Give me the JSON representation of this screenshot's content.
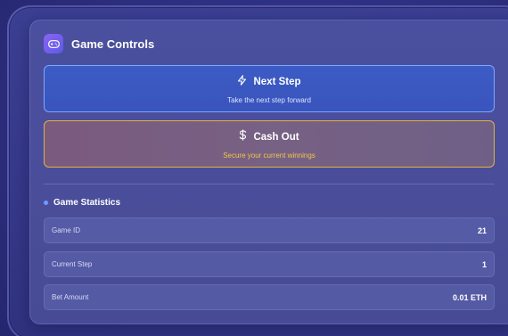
{
  "header": {
    "title": "Game Controls",
    "icon": "gamepad-icon"
  },
  "buttons": {
    "next_step": {
      "label": "Next Step",
      "subtitle": "Take the next step forward",
      "icon": "lightning-icon",
      "border_color": "#7da7ff"
    },
    "cash_out": {
      "label": "Cash Out",
      "subtitle": "Secure your current winnings",
      "icon": "dollar-icon",
      "border_color": "#e0b43a"
    }
  },
  "statistics": {
    "title": "Game Statistics",
    "rows": [
      {
        "label": "Game ID",
        "value": "21"
      },
      {
        "label": "Current Step",
        "value": "1"
      },
      {
        "label": "Bet Amount",
        "value": "0.01 ETH"
      }
    ]
  }
}
